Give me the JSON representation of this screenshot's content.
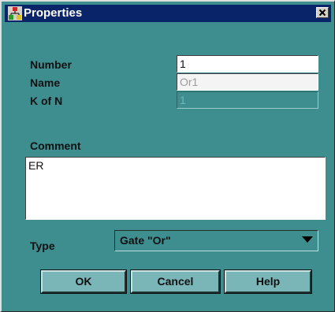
{
  "window": {
    "title": "Properties"
  },
  "icons": {
    "app": "properties-app-icon",
    "close": "close-icon",
    "dropdown": "dropdown-arrow-icon"
  },
  "colors": {
    "dialog_bg": "#3e8e90",
    "titlebar": "#0a246a",
    "button_face": "#7ab6b8"
  },
  "form": {
    "number": {
      "label": "Number",
      "value": "1"
    },
    "name": {
      "label": "Name",
      "value": "Or1"
    },
    "kofn": {
      "label": "K of N",
      "value": "1"
    },
    "comment": {
      "label": "Comment",
      "value": "ER"
    },
    "type": {
      "label": "Type",
      "value": "Gate \"Or\""
    }
  },
  "buttons": {
    "ok": "OK",
    "cancel": "Cancel",
    "help": "Help"
  }
}
